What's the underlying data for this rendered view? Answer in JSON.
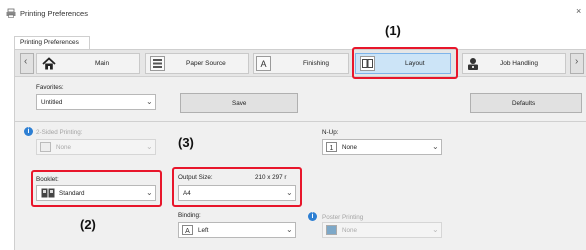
{
  "window": {
    "title": "Printing Preferences",
    "close_glyph": "×"
  },
  "tab": {
    "label": "Printing Preferences"
  },
  "tabs": [
    {
      "label": "Main",
      "icon": "home-icon"
    },
    {
      "label": "Paper Source",
      "icon": "paper-tray-icon"
    },
    {
      "label": "Finishing",
      "icon": "finishing-icon"
    },
    {
      "label": "Layout",
      "icon": "layout-icon",
      "selected": true
    },
    {
      "label": "Job Handling",
      "icon": "job-handling-icon"
    }
  ],
  "nav": {
    "prev": "‹",
    "next": "›"
  },
  "favorites": {
    "label": "Favorites:",
    "value": "Untitled",
    "save": "Save",
    "defaults": "Defaults"
  },
  "two_sided": {
    "label": "2-Sided Printing:",
    "value": "None"
  },
  "booklet": {
    "label": "Booklet:",
    "value": "Standard"
  },
  "output_size": {
    "label": "Output Size:",
    "dims": "210 x 297 r",
    "value": "A4"
  },
  "nup": {
    "label": "N-Up:",
    "value": "None"
  },
  "binding": {
    "label": "Binding:",
    "value": "Left"
  },
  "poster": {
    "label": "Poster Printing",
    "value": "None"
  },
  "callouts": {
    "c1": "(1)",
    "c2": "(2)",
    "c3": "(3)"
  },
  "colors": {
    "callout_red": "#e8162b",
    "selected_tab": "#cce4f7",
    "info_blue": "#2d7fd3"
  }
}
